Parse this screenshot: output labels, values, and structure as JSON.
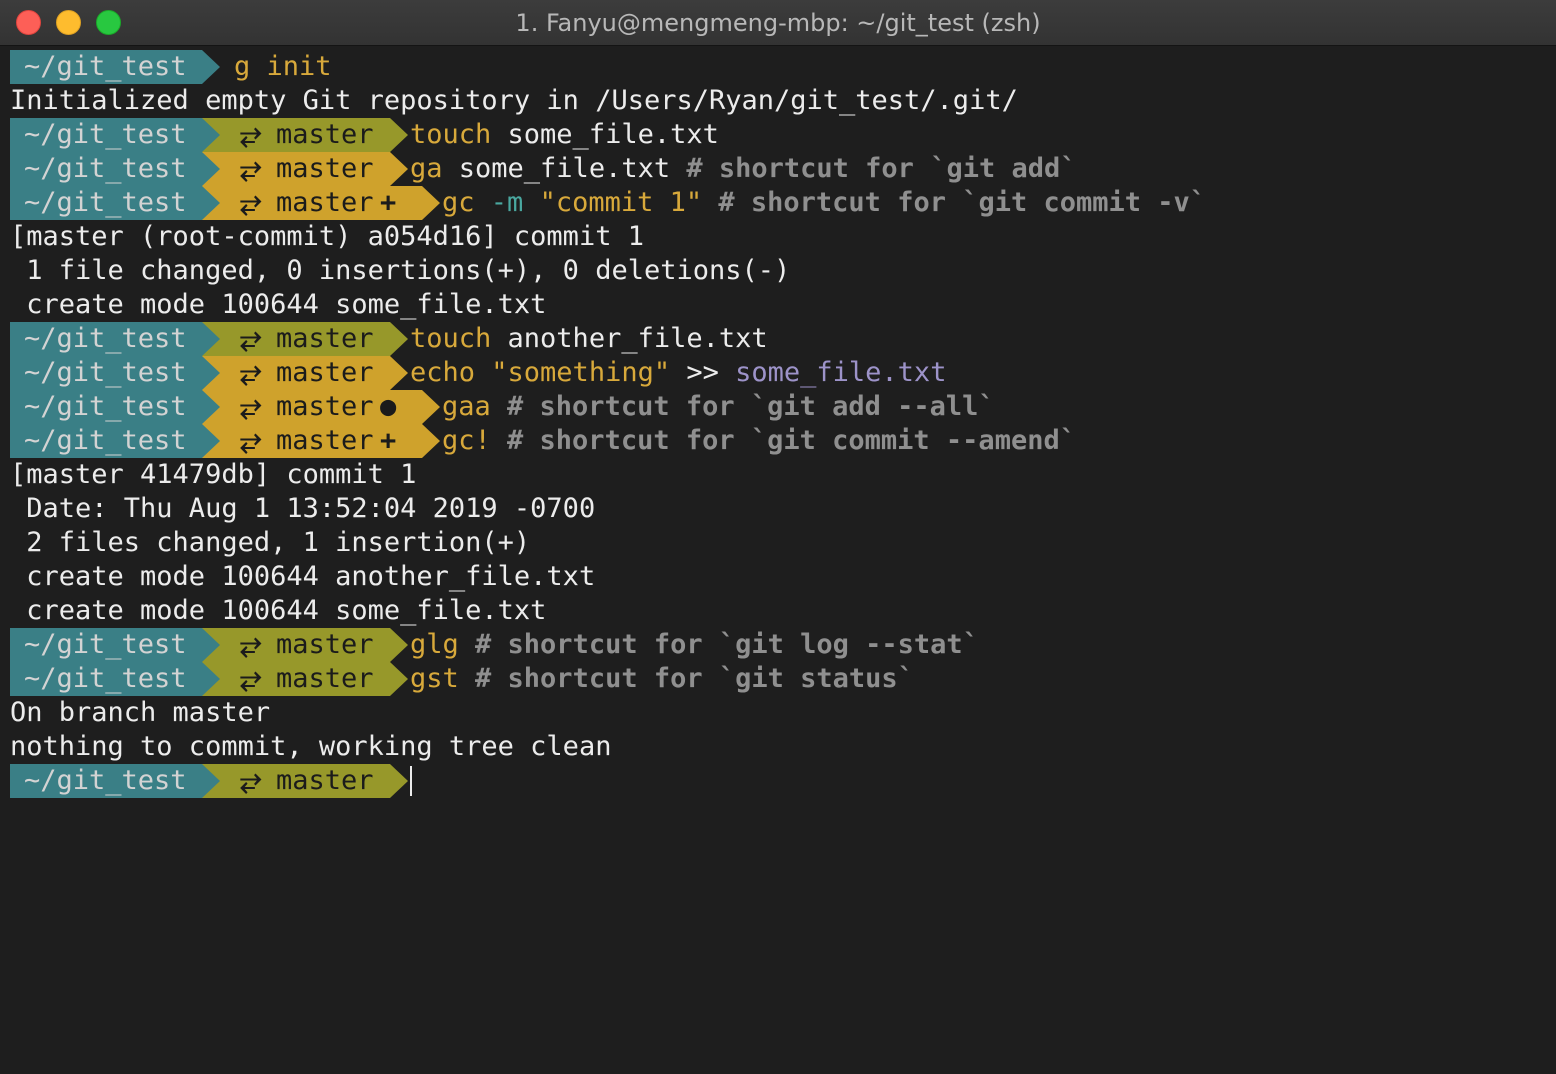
{
  "window": {
    "title": "1. Fanyu@mengmeng-mbp: ~/git_test (zsh)"
  },
  "prompt": {
    "dir": "~/git_test",
    "branch": "master",
    "branch_icon": "⥂",
    "dirty_symbol_staged": "+",
    "dirty_symbol_unstaged": "●"
  },
  "lines": [
    {
      "type": "prompt-nogit",
      "cmd": [
        "g init"
      ]
    },
    {
      "type": "output",
      "text": "Initialized empty Git repository in /Users/Ryan/git_test/.git/"
    },
    {
      "type": "prompt",
      "cmd": [
        "touch",
        " some_file.txt"
      ]
    },
    {
      "type": "prompt",
      "cmd": [
        "ga",
        " some_file.txt ",
        "# shortcut for `git add`"
      ]
    },
    {
      "type": "prompt",
      "cmd": [
        "gc ",
        "-m ",
        "\"commit 1\"",
        " # shortcut for `git commit -v`"
      ]
    },
    {
      "type": "output",
      "text": "[master (root-commit) a054d16] commit 1"
    },
    {
      "type": "output",
      "text": " 1 file changed, 0 insertions(+), 0 deletions(-)"
    },
    {
      "type": "output",
      "text": " create mode 100644 some_file.txt"
    },
    {
      "type": "prompt",
      "cmd": [
        "touch",
        " another_file.txt"
      ]
    },
    {
      "type": "prompt",
      "cmd": [
        "echo ",
        "\"something\"",
        " >> ",
        "some_file.txt"
      ]
    },
    {
      "type": "prompt",
      "cmd": [
        "gaa ",
        "# shortcut for `git add --all`"
      ]
    },
    {
      "type": "prompt",
      "cmd": [
        "gc! ",
        "# shortcut for `git commit --amend`"
      ]
    },
    {
      "type": "output",
      "text": "[master 41479db] commit 1"
    },
    {
      "type": "output",
      "text": " Date: Thu Aug 1 13:52:04 2019 -0700"
    },
    {
      "type": "output",
      "text": " 2 files changed, 1 insertion(+)"
    },
    {
      "type": "output",
      "text": " create mode 100644 another_file.txt"
    },
    {
      "type": "output",
      "text": " create mode 100644 some_file.txt"
    },
    {
      "type": "prompt",
      "cmd": [
        "glg ",
        "# shortcut for `git log --stat`"
      ]
    },
    {
      "type": "prompt",
      "cmd": [
        "gst ",
        "# shortcut for `git status`"
      ]
    },
    {
      "type": "output",
      "text": "On branch master"
    },
    {
      "type": "output",
      "text": "nothing to commit, working tree clean"
    },
    {
      "type": "prompt",
      "cmd": []
    }
  ],
  "colors": {
    "background": "#1e1e1e",
    "dir_segment": "#3a7f86",
    "git_clean_segment": "#97982a",
    "git_dirty_segment": "#cfa22c"
  }
}
